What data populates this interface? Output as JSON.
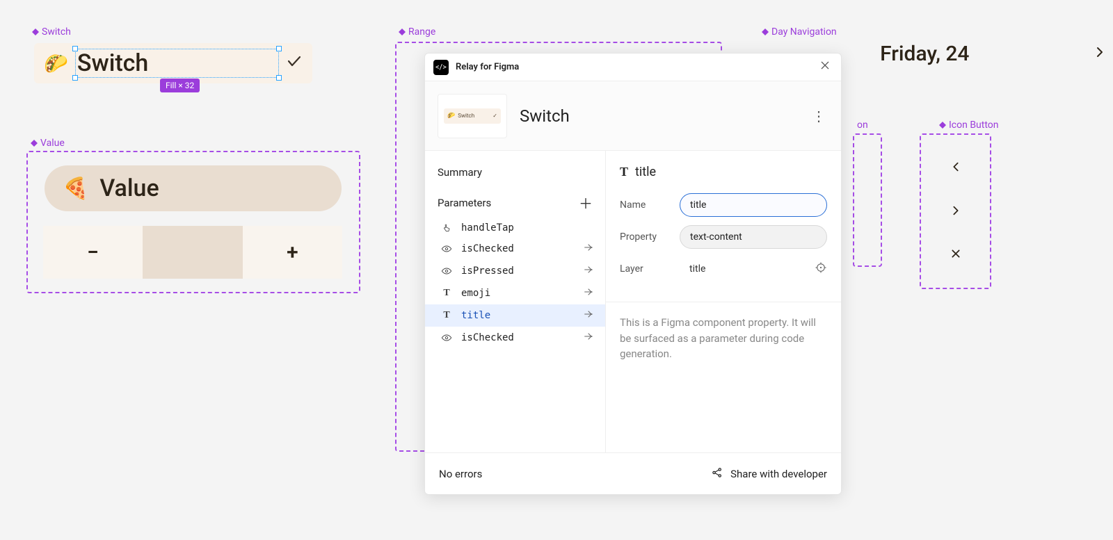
{
  "canvas": {
    "switch": {
      "label": "Switch",
      "emoji": "🌮",
      "title": "Switch",
      "fill_badge": "Fill × 32"
    },
    "value": {
      "label": "Value",
      "emoji": "🍕",
      "title": "Value",
      "minus": "−",
      "plus": "+"
    },
    "range": {
      "label": "Range"
    },
    "daynav": {
      "label": "Day Navigation",
      "date": "Friday, 24"
    },
    "iconbtn": {
      "label": "Icon Button",
      "label2": "on"
    }
  },
  "relay": {
    "title": "Relay for Figma",
    "component_name": "Switch",
    "thumb_text": "Switch",
    "left": {
      "summary": "Summary",
      "parameters": "Parameters",
      "params": [
        {
          "icon": "tap",
          "name": "handleTap",
          "arrow": false
        },
        {
          "icon": "eye",
          "name": "isChecked",
          "arrow": true
        },
        {
          "icon": "eye",
          "name": "isPressed",
          "arrow": true
        },
        {
          "icon": "T",
          "name": "emoji",
          "arrow": true
        },
        {
          "icon": "T",
          "name": "title",
          "arrow": true,
          "selected": true
        },
        {
          "icon": "eye",
          "name": "isChecked",
          "arrow": true
        }
      ]
    },
    "right": {
      "heading_icon": "T",
      "heading_text": "title",
      "name_label": "Name",
      "name_value": "title",
      "property_label": "Property",
      "property_value": "text-content",
      "layer_label": "Layer",
      "layer_value": "title",
      "description": "This is a Figma component property. It will be surfaced as a parameter during code generation."
    },
    "footer": {
      "no_errors": "No errors",
      "share": "Share with developer"
    }
  }
}
